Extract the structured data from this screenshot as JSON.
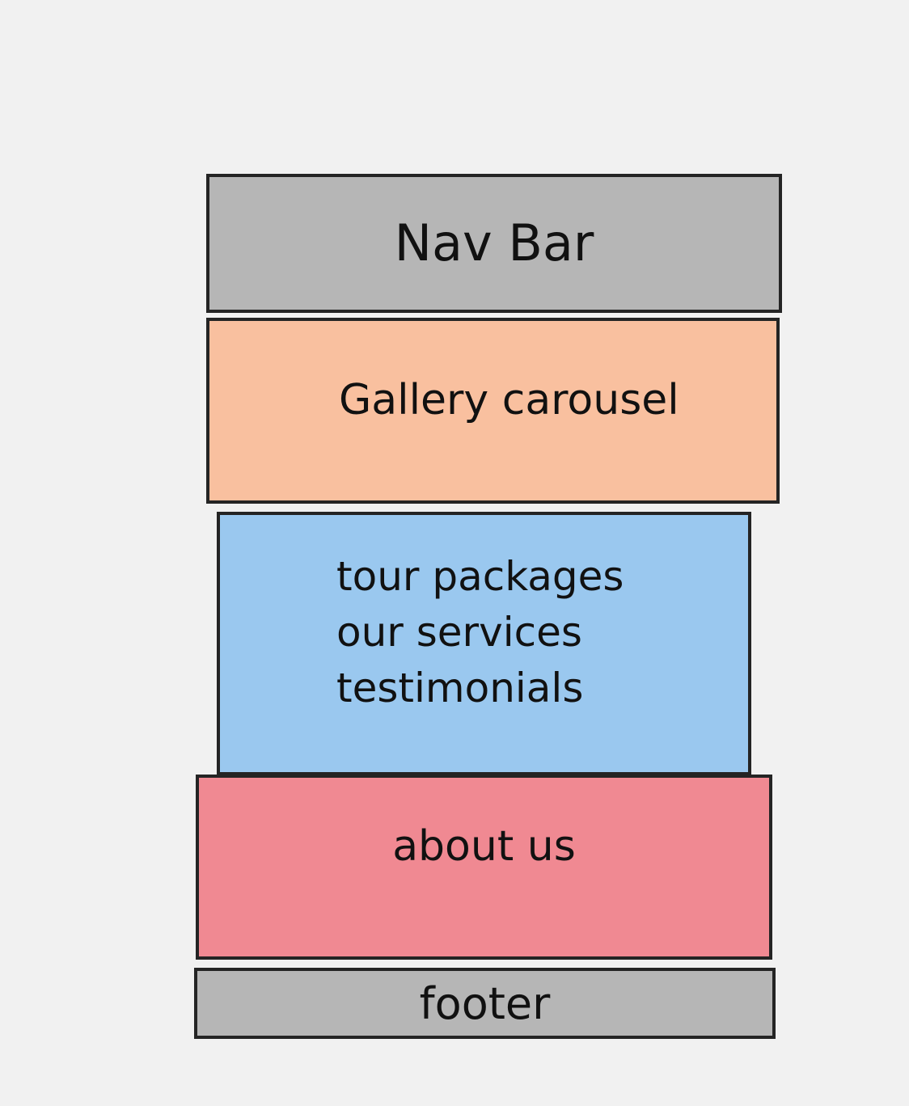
{
  "colors": {
    "background": "#f1f1f1",
    "border": "#242424",
    "nav_fill": "#b6b6b6",
    "gallery_fill": "#f9c09f",
    "content_fill": "#9ac8ef",
    "about_fill": "#f08992",
    "footer_fill": "#b6b6b6"
  },
  "blocks": {
    "nav": {
      "label": "Nav Bar"
    },
    "gallery": {
      "label": "Gallery carousel"
    },
    "content": {
      "lines": [
        "tour packages",
        "our services",
        "testimonials"
      ]
    },
    "about": {
      "label": "about us"
    },
    "footer": {
      "label": "footer"
    }
  }
}
